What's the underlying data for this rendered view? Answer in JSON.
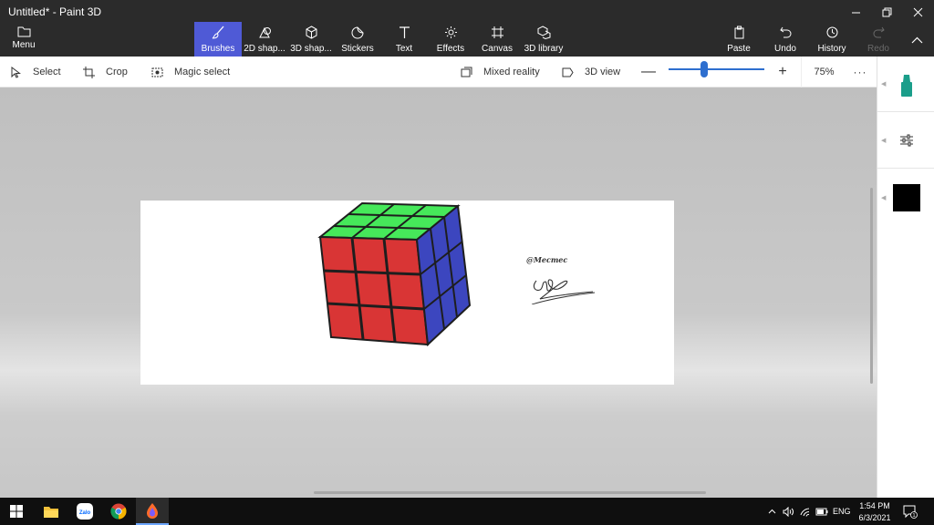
{
  "window": {
    "title": "Untitled* - Paint 3D"
  },
  "menu": {
    "label": "Menu"
  },
  "ribbon": {
    "tools": [
      {
        "label": "Brushes",
        "icon": "brush-icon",
        "active": true
      },
      {
        "label": "2D shap...",
        "icon": "2d-shapes-icon"
      },
      {
        "label": "3D shap...",
        "icon": "3d-shapes-icon"
      },
      {
        "label": "Stickers",
        "icon": "stickers-icon"
      },
      {
        "label": "Text",
        "icon": "text-icon"
      },
      {
        "label": "Effects",
        "icon": "effects-icon"
      },
      {
        "label": "Canvas",
        "icon": "canvas-icon"
      },
      {
        "label": "3D library",
        "icon": "3d-library-icon"
      }
    ],
    "actions": {
      "paste": "Paste",
      "undo": "Undo",
      "history": "History",
      "redo": "Redo"
    }
  },
  "toolbar": {
    "select": "Select",
    "crop": "Crop",
    "magic_select": "Magic select",
    "mixed_reality": "Mixed reality",
    "view_3d": "3D view",
    "zoom_minus": "—",
    "zoom_plus": "+",
    "zoom_percent": "75%",
    "zoom_level": 0.37,
    "more": "···"
  },
  "canvas": {
    "watermark": "@Mecmec",
    "cube_colors": {
      "top": "#46e85a",
      "front": "#d93535",
      "side": "#3c46bf",
      "lines": "#1e1e1e"
    }
  },
  "sidepanel": {
    "current_color": "#000000",
    "marker_color": "#1a9e8a"
  },
  "taskbar": {
    "language": "ENG",
    "time": "1:54 PM",
    "date": "6/3/2021",
    "zalo_label": "Zalo",
    "notification_count": "1"
  },
  "colors": {
    "titlebar_bg": "#2b2b2b",
    "accent": "#4f5ad6",
    "zoom_accent": "#2e6fcf"
  }
}
